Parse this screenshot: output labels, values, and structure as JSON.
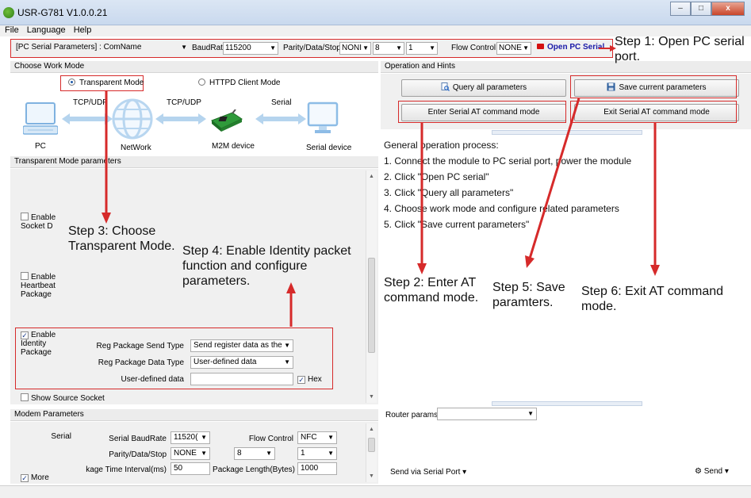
{
  "window": {
    "title": "USR-G781 V1.0.0.21",
    "buttons": [
      "–",
      "□",
      "x"
    ]
  },
  "menu": [
    "File",
    "Language",
    "Help"
  ],
  "toolbar": {
    "port_label": "[PC Serial Parameters] : ComName",
    "baud_label": "BaudRate",
    "baud_value": "115200",
    "parity_label": "Parity/Data/Stop",
    "parity_value": "NONI",
    "data_value": "8",
    "stop_value": "1",
    "flow_label": "Flow Control",
    "flow_value": "NONE",
    "open_button": "Open PC Serial"
  },
  "work_mode": {
    "header": "Choose Work Mode",
    "transparent": "Transparent Mode",
    "httpd": "HTTPD Client Mode",
    "labels": {
      "tcp1": "TCP/UDP",
      "tcp2": "TCP/UDP",
      "serial": "Serial",
      "pc": "PC",
      "network": "NetWork",
      "m2m": "M2M device",
      "serial_device": "Serial device"
    }
  },
  "transparent_params": {
    "header": "Transparent Mode parameters",
    "enable_socket": "Enable Socket D",
    "enable_heartbeat": "Enable Heartbeat Package",
    "enable_identity": "Enable Identity Package",
    "reg_send_type_label": "Reg Package Send Type",
    "reg_send_type_value": "Send register data as the",
    "reg_data_type_label": "Reg Package Data Type",
    "reg_data_type_value": "User-defined data",
    "user_data_label": "User-defined data",
    "user_data_value": "",
    "hex_label": "Hex",
    "show_source": "Show Source Socket"
  },
  "modem": {
    "header": "Modem Parameters",
    "serial_label": "Serial",
    "baud_label": "Serial BaudRate",
    "baud_value": "11520(",
    "flow_label": "Flow Control",
    "flow_value": "NFC",
    "parity_label": "Parity/Data/Stop",
    "parity_value": "NONE",
    "data_value": "8",
    "stop_value": "1",
    "interval_label": "kage Time Interval(ms)",
    "interval_value": "50",
    "length_label": "Package Length(Bytes)",
    "length_value": "1000",
    "more_label": "More"
  },
  "operation": {
    "header": "Operation and Hints",
    "query_button": "Query all parameters",
    "save_button": "Save current parameters",
    "enter_at_button": "Enter Serial AT command mode",
    "exit_at_button": "Exit Serial AT command mode",
    "hints": [
      "General operation process:",
      "1. Connect the module to PC serial port, power the module",
      "2. Click \"Open PC serial\"",
      "3. Click \"Query all parameters\"",
      "4. Choose work mode and configure related parameters",
      "5. Click \"Save current parameters\""
    ],
    "router_label": "Router params",
    "send_via": "Send via Serial Port",
    "send_button": "Send"
  },
  "annotations": {
    "step1": "Step 1: Open PC serial port.",
    "step2": "Step 2: Enter AT command mode.",
    "step3": "Step 3: Choose Transparent Mode.",
    "step4": "Step 4: Enable Identity packet function and configure parameters.",
    "step5": "Step 5: Save paramters.",
    "step6": "Step 6: Exit AT command mode."
  },
  "colors": {
    "annotation_red": "#d62a2a",
    "open_button_blue": "#1a1aa8",
    "title_bar": "#c9d9ee"
  }
}
